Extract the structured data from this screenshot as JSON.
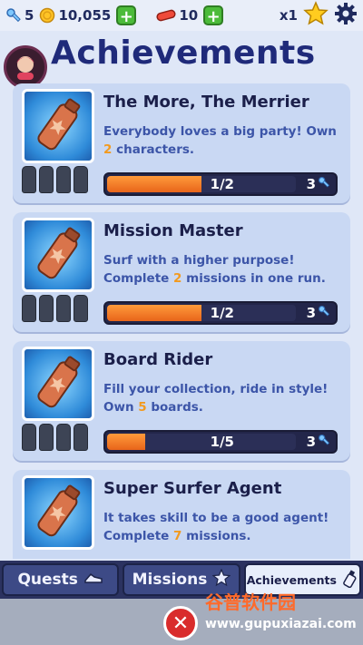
{
  "topbar": {
    "keys": "5",
    "coins": "10,055",
    "boards": "10",
    "multiplier": "x1"
  },
  "header": {
    "title": "Achievements"
  },
  "cards": [
    {
      "title": "The More, The Merrier",
      "desc_before": "Everybody loves a big party! Own ",
      "desc_num": "2",
      "desc_after": " characters.",
      "progress_text": "1/2",
      "progress": 0.5,
      "reward": "3"
    },
    {
      "title": "Mission Master",
      "desc_before": "Surf with a higher purpose! Complete ",
      "desc_num": "2",
      "desc_after": " missions in one run.",
      "progress_text": "1/2",
      "progress": 0.5,
      "reward": "3"
    },
    {
      "title": "Board Rider",
      "desc_before": "Fill your collection, ride in style! Own ",
      "desc_num": "5",
      "desc_after": " boards.",
      "progress_text": "1/5",
      "progress": 0.2,
      "reward": "3"
    },
    {
      "title": "Super Surfer Agent",
      "desc_before": "It takes skill to be a good agent! Complete ",
      "desc_num": "7",
      "desc_after": " missions.",
      "progress_text": "",
      "progress": 0,
      "reward": ""
    }
  ],
  "tabs": [
    {
      "label": "Quests"
    },
    {
      "label": "Missions"
    },
    {
      "label": "Achievements"
    }
  ],
  "watermark": {
    "line1": "谷普软件园",
    "line2": "www.gupuxiazai.com"
  },
  "colors": {
    "accent": "#f29a1f",
    "title": "#1f2a7a",
    "desc": "#3c55a8"
  }
}
